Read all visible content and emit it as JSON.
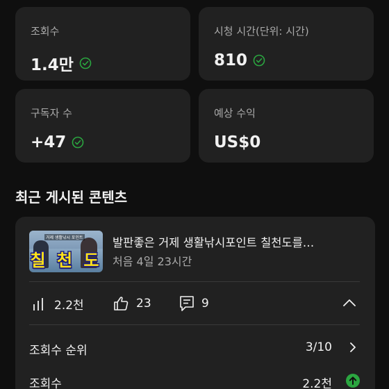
{
  "stats": [
    {
      "label": "조회수",
      "value": "1.4만"
    },
    {
      "label": "시청 시간(단위: 시간)",
      "value": "810"
    },
    {
      "label": "구독자 수",
      "value": "+47"
    },
    {
      "label": "예상 수익",
      "value": "US$0"
    }
  ],
  "recent": {
    "title": "최근 게시된 콘텐츠",
    "video": {
      "thumbnail_caption": "거제 생활낚시 포인트",
      "thumbnail_text": "칠 천 도",
      "title": "발판좋은 거제 생활낚시포인트 칠천도를…",
      "meta": "처음 4일 23시간"
    },
    "metrics": {
      "views": "2.2천",
      "likes": "23",
      "comments": "9"
    },
    "rows": [
      {
        "label": "조회수 순위",
        "value": "3/10"
      },
      {
        "label": "조회수",
        "value": "2.2천"
      }
    ]
  },
  "colors": {
    "background": "#0f0f0f",
    "card": "#212121",
    "check": "#2ba640",
    "up_badge": "#2ba640"
  }
}
